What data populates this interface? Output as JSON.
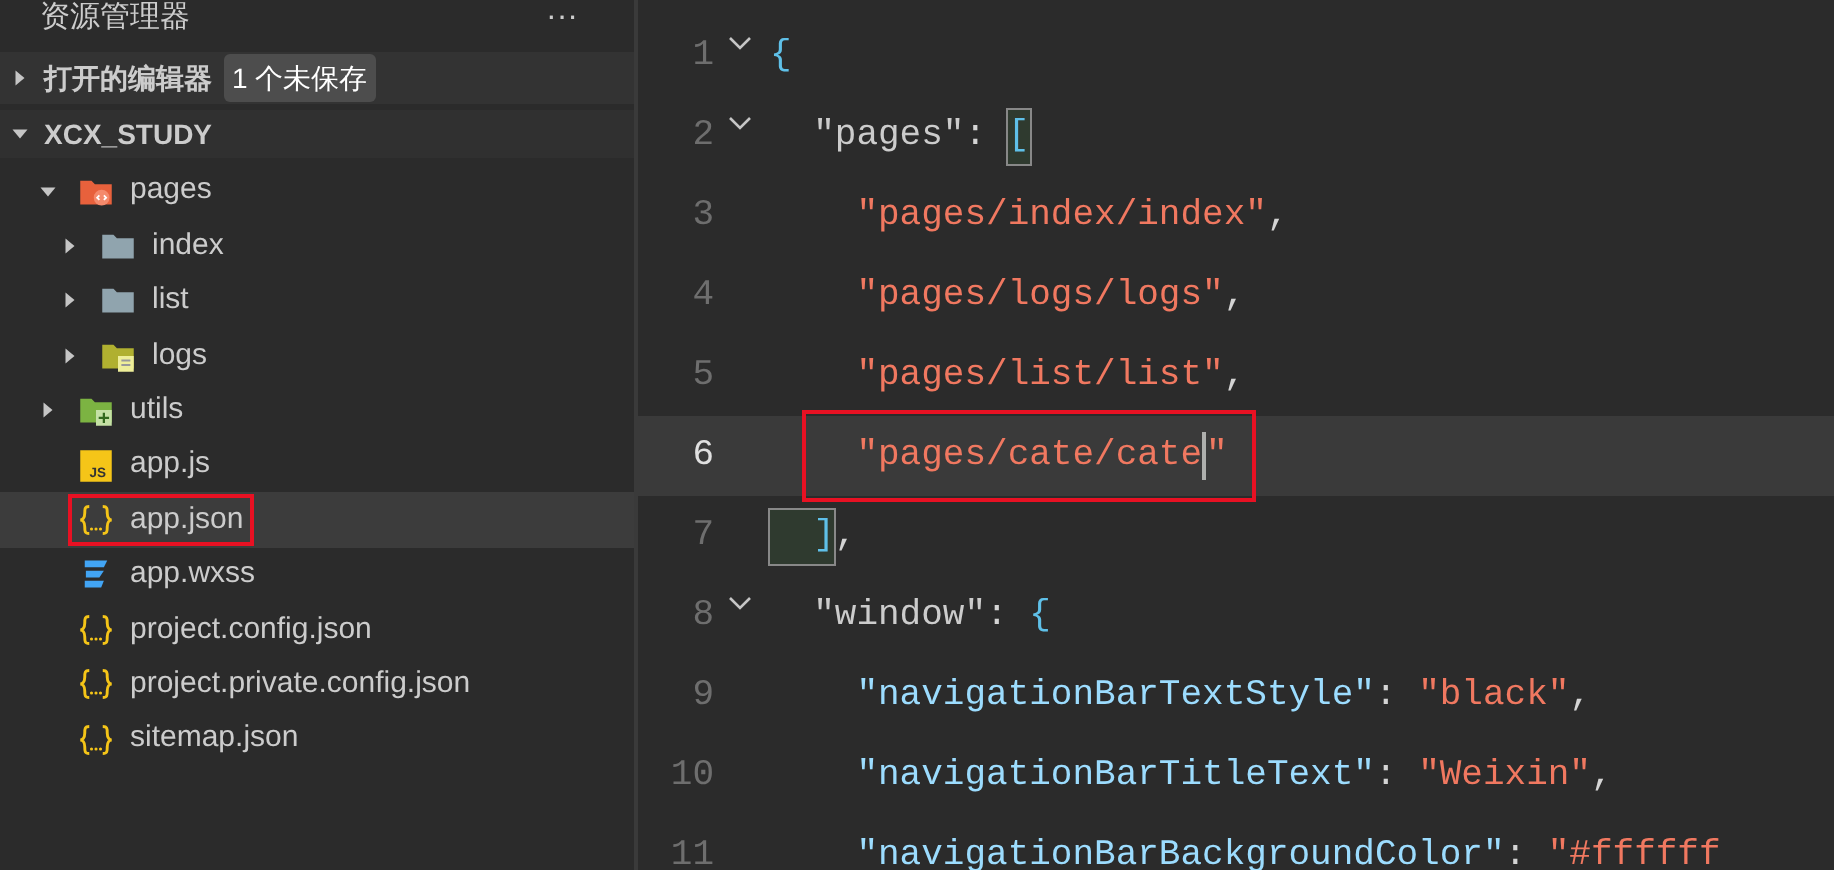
{
  "sidebar": {
    "title": "资源管理器",
    "more": "···",
    "open_editors": {
      "label": "打开的编辑器",
      "expanded": false,
      "badge": "1 个未保存"
    },
    "project": {
      "label": "XCX_STUDY",
      "expanded": true,
      "items": [
        {
          "name": "pages",
          "kind": "pagesfolder",
          "expanded": true,
          "selected": false,
          "annotated": false,
          "children": [
            {
              "name": "index",
              "kind": "folder",
              "expanded": false,
              "selected": false,
              "annotated": false
            },
            {
              "name": "list",
              "kind": "folder",
              "expanded": false,
              "selected": false,
              "annotated": false
            },
            {
              "name": "logs",
              "kind": "logfolder",
              "expanded": false,
              "selected": false,
              "annotated": false
            }
          ]
        },
        {
          "name": "utils",
          "kind": "utilfolder",
          "expanded": false,
          "selected": false,
          "annotated": false
        },
        {
          "name": "app.js",
          "kind": "script",
          "icon_text": "JS",
          "selected": false,
          "annotated": false
        },
        {
          "name": "app.json",
          "kind": "data",
          "selected": true,
          "annotated": true
        },
        {
          "name": "app.wxss",
          "kind": "style",
          "selected": false,
          "annotated": false
        },
        {
          "name": "project.config.json",
          "kind": "data",
          "selected": false,
          "annotated": false
        },
        {
          "name": "project.private.config.json",
          "kind": "data",
          "selected": false,
          "annotated": false
        },
        {
          "name": "sitemap.json",
          "kind": "data",
          "selected": false,
          "annotated": false
        }
      ]
    }
  },
  "editor": {
    "lines": [
      {
        "number": "1",
        "fold": true,
        "current": false,
        "annotated": false,
        "tokens": [
          {
            "kind": "brace",
            "text": "{"
          }
        ]
      },
      {
        "number": "2",
        "fold": true,
        "current": false,
        "annotated": false,
        "tokens": [
          {
            "kind": "key",
            "text": "  \"pages\""
          },
          {
            "kind": "punct",
            "text": ": "
          },
          {
            "kind": "brace",
            "text": "[",
            "matched": true
          }
        ]
      },
      {
        "number": "3",
        "fold": false,
        "current": false,
        "annotated": false,
        "tokens": [
          {
            "kind": "string",
            "text": "    \"pages/index/index\""
          },
          {
            "kind": "punct",
            "text": ","
          }
        ]
      },
      {
        "number": "4",
        "fold": false,
        "current": false,
        "annotated": false,
        "tokens": [
          {
            "kind": "string",
            "text": "    \"pages/logs/logs\""
          },
          {
            "kind": "punct",
            "text": ","
          }
        ]
      },
      {
        "number": "5",
        "fold": false,
        "current": false,
        "annotated": false,
        "tokens": [
          {
            "kind": "string",
            "text": "    \"pages/list/list\""
          },
          {
            "kind": "punct",
            "text": ","
          }
        ]
      },
      {
        "number": "6",
        "fold": false,
        "current": true,
        "annotated": true,
        "tokens": [
          {
            "kind": "string",
            "text": "    \"pages/cate/cate"
          },
          {
            "kind": "cursor"
          },
          {
            "kind": "string",
            "text": "\""
          }
        ]
      },
      {
        "number": "7",
        "fold": false,
        "current": false,
        "annotated": false,
        "tokens": [
          {
            "kind": "brace",
            "text": "  ]",
            "matched": true
          },
          {
            "kind": "punct",
            "text": ","
          }
        ]
      },
      {
        "number": "8",
        "fold": true,
        "current": false,
        "annotated": false,
        "tokens": [
          {
            "kind": "key",
            "text": "  \"window\""
          },
          {
            "kind": "punct",
            "text": ": "
          },
          {
            "kind": "brace",
            "text": "{"
          }
        ]
      },
      {
        "number": "9",
        "fold": false,
        "current": false,
        "annotated": false,
        "tokens": [
          {
            "kind": "prop",
            "text": "    \"navigationBarTextStyle\""
          },
          {
            "kind": "punct",
            "text": ": "
          },
          {
            "kind": "string",
            "text": "\"black\""
          },
          {
            "kind": "punct",
            "text": ","
          }
        ]
      },
      {
        "number": "10",
        "fold": false,
        "current": false,
        "annotated": false,
        "tokens": [
          {
            "kind": "prop",
            "text": "    \"navigationBarTitleText\""
          },
          {
            "kind": "punct",
            "text": ": "
          },
          {
            "kind": "string",
            "text": "\"Weixin\""
          },
          {
            "kind": "punct",
            "text": ","
          }
        ]
      },
      {
        "number": "11",
        "fold": false,
        "current": false,
        "annotated": false,
        "tokens": [
          {
            "kind": "prop",
            "text": "    \"navigationBarBackgroundColor\""
          },
          {
            "kind": "punct",
            "text": ": "
          },
          {
            "kind": "string",
            "text": "\"#ffffff"
          }
        ]
      }
    ]
  }
}
